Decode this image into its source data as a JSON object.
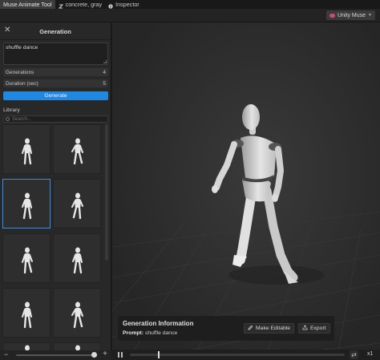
{
  "tabs": [
    {
      "label": "Muse Animate Tool",
      "icon": "none"
    },
    {
      "label": "concrete, gray",
      "icon": "material-icon"
    },
    {
      "label": "Inspector",
      "icon": "info-icon"
    }
  ],
  "account": {
    "label": "Unity Muse"
  },
  "panel": {
    "title": "Generation",
    "prompt_value": "shuffle dance",
    "fields": [
      {
        "label": "Generations",
        "value": "4"
      },
      {
        "label": "Duration (sec)",
        "value": "5"
      }
    ],
    "generate_label": "Generate",
    "library_label": "Library",
    "search_placeholder": "Search..."
  },
  "info": {
    "title": "Generation Information",
    "prompt_label": "Prompt:",
    "prompt_value": "shuffle dance",
    "make_editable_label": "Make Editable",
    "export_label": "Export"
  },
  "timeline": {
    "speed": "x1",
    "progress": 0.13
  },
  "colors": {
    "accent": "#1e88e5",
    "selection": "#3a8de0",
    "brand": "#c84a7a"
  }
}
